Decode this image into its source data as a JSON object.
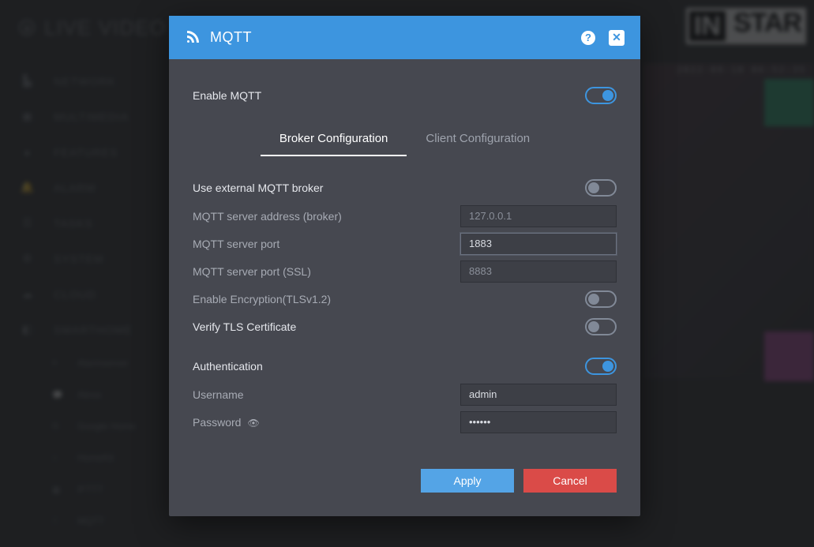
{
  "page": {
    "title": "LIVE VIDEO",
    "timestamp": "2022-09-18 06:52:35"
  },
  "brand": {
    "part1": "IN",
    "part2": "STAR"
  },
  "nav": {
    "items": [
      {
        "icon": "sitemap",
        "label": "NETWORK"
      },
      {
        "icon": "image",
        "label": "MULTIMEDIA"
      },
      {
        "icon": "dot",
        "label": "FEATURES"
      },
      {
        "icon": "bell",
        "label": "ALARM"
      },
      {
        "icon": "tasks",
        "label": "TASKS"
      },
      {
        "icon": "gear",
        "label": "SYSTEM"
      },
      {
        "icon": "cloud",
        "label": "CLOUD"
      },
      {
        "icon": "smart",
        "label": "SMARTHOME"
      }
    ],
    "subitems": [
      {
        "icon": "server",
        "label": "Alarmserver"
      },
      {
        "icon": "comment",
        "label": "Alexa"
      },
      {
        "icon": "g",
        "label": "Google Home"
      },
      {
        "icon": "home",
        "label": "HomeKit"
      },
      {
        "icon": "link",
        "label": "IFTTT"
      },
      {
        "icon": "rss",
        "label": "MQTT"
      }
    ]
  },
  "modal": {
    "title": "MQTT",
    "enable_label": "Enable MQTT",
    "enable_value": true,
    "tabs": {
      "broker": "Broker Configuration",
      "client": "Client Configuration",
      "active": "broker"
    },
    "broker": {
      "external_label": "Use external MQTT broker",
      "external_value": false,
      "addr_label": "MQTT server address (broker)",
      "addr_value": "127.0.0.1",
      "port_label": "MQTT server port",
      "port_value": "1883",
      "ssl_label": "MQTT server port (SSL)",
      "ssl_value": "8883",
      "enc_label": "Enable Encryption(TLSv1.2)",
      "enc_value": false,
      "verify_label": "Verify TLS Certificate",
      "verify_value": false,
      "auth_label": "Authentication",
      "auth_value": true,
      "user_label": "Username",
      "user_value": "admin",
      "pass_label": "Password",
      "pass_value": "••••••"
    },
    "buttons": {
      "apply": "Apply",
      "cancel": "Cancel"
    }
  }
}
